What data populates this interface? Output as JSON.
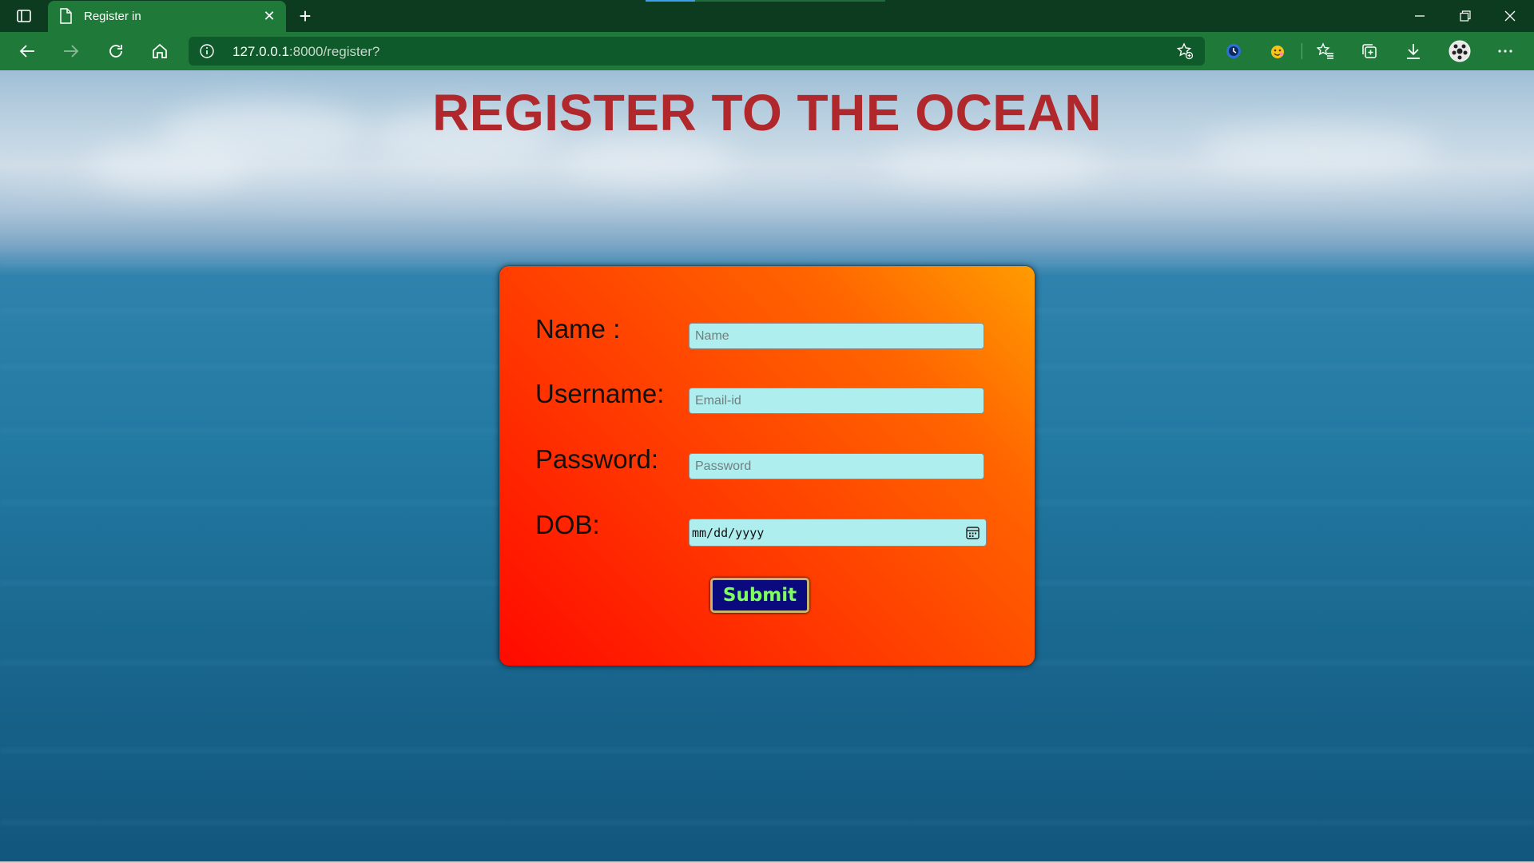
{
  "browser": {
    "tab_title": "Register in",
    "url_host": "127.0.0.1",
    "url_path": ":8000/register?",
    "icons": {
      "tab_actions": "tab-actions-icon",
      "tab_page": "document-icon",
      "close": "close-icon",
      "new_tab": "plus-icon",
      "back": "back-arrow-icon",
      "forward": "forward-arrow-icon",
      "refresh": "refresh-icon",
      "home": "home-icon",
      "site_info": "info-icon",
      "favorite_add": "star-add-icon",
      "extension_1": "clock-extension-icon",
      "extension_2": "emoji-extension-icon",
      "favorites": "favorites-list-icon",
      "collections": "collections-icon",
      "downloads": "download-icon",
      "profile": "profile-avatar-icon",
      "more": "more-dots-icon"
    }
  },
  "page": {
    "heading": "REGISTER TO THE OCEAN",
    "form": {
      "name_label": "Name :",
      "name_placeholder": "Name",
      "username_label": "Username:",
      "username_placeholder": "Email-id",
      "password_label": "Password:",
      "password_placeholder": "Password",
      "dob_label": "DOB:",
      "dob_placeholder": "mm/dd/yyyy",
      "submit_label": "Submit"
    }
  },
  "colors": {
    "chrome_dark": "#0d3b1f",
    "chrome_green": "#1f7a3a",
    "heading": "#b0282c",
    "field_bg": "#afeeee",
    "button_bg": "#0a0a7e",
    "button_text": "#7fff5a"
  }
}
